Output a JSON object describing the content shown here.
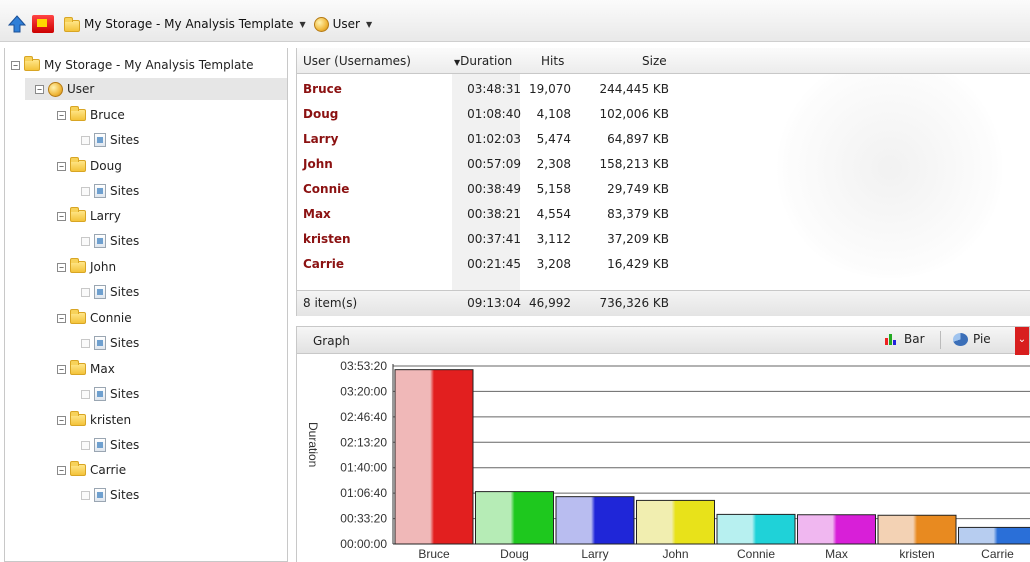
{
  "toolbar": {
    "breadcrumb_storage": "My Storage - My Analysis Template",
    "breadcrumb_user": "User"
  },
  "tree": {
    "root": "My Storage - My Analysis Template",
    "user": "User",
    "users": [
      {
        "name": "Bruce",
        "child": "Sites"
      },
      {
        "name": "Doug",
        "child": "Sites"
      },
      {
        "name": "Larry",
        "child": "Sites"
      },
      {
        "name": "John",
        "child": "Sites"
      },
      {
        "name": "Connie",
        "child": "Sites"
      },
      {
        "name": "Max",
        "child": "Sites"
      },
      {
        "name": "kristen",
        "child": "Sites"
      },
      {
        "name": "Carrie",
        "child": "Sites"
      }
    ]
  },
  "table": {
    "columns": [
      "User (Usernames)",
      "Duration",
      "Hits",
      "Size"
    ],
    "rows": [
      {
        "user": "Bruce",
        "duration": "03:48:31",
        "hits": "19,070",
        "size": "244,445 KB"
      },
      {
        "user": "Doug",
        "duration": "01:08:40",
        "hits": "4,108",
        "size": "102,006 KB"
      },
      {
        "user": "Larry",
        "duration": "01:02:03",
        "hits": "5,474",
        "size": "64,897 KB"
      },
      {
        "user": "John",
        "duration": "00:57:09",
        "hits": "2,308",
        "size": "158,213 KB"
      },
      {
        "user": "Connie",
        "duration": "00:38:49",
        "hits": "5,158",
        "size": "29,749 KB"
      },
      {
        "user": "Max",
        "duration": "00:38:21",
        "hits": "4,554",
        "size": "83,379 KB"
      },
      {
        "user": "kristen",
        "duration": "00:37:41",
        "hits": "3,112",
        "size": "37,209 KB"
      },
      {
        "user": "Carrie",
        "duration": "00:21:45",
        "hits": "3,208",
        "size": "16,429 KB"
      }
    ],
    "footer": {
      "count": "8 item(s)",
      "duration": "09:13:04",
      "hits": "46,992",
      "size": "736,326 KB"
    }
  },
  "graph": {
    "title": "Graph",
    "bar_label": "Bar",
    "pie_label": "Pie"
  },
  "chart_data": {
    "type": "bar",
    "ylabel": "Duration",
    "categories": [
      "Bruce",
      "Doug",
      "Larry",
      "John",
      "Connie",
      "Max",
      "kristen",
      "Carrie"
    ],
    "values": [
      "03:48:31",
      "01:08:40",
      "01:02:03",
      "00:57:09",
      "00:38:49",
      "00:38:21",
      "00:37:41",
      "00:21:45"
    ],
    "y_ticks": [
      "00:00:00",
      "00:33:20",
      "01:06:40",
      "01:40:00",
      "02:13:20",
      "02:46:40",
      "03:20:00",
      "03:53:20"
    ],
    "ylim": [
      "00:00:00",
      "03:53:20"
    ],
    "grid": true,
    "colors": [
      [
        "#f0b8b8",
        "#e21f1f"
      ],
      [
        "#b6ecb6",
        "#1ec81e"
      ],
      [
        "#b9bdf0",
        "#1f26d8"
      ],
      [
        "#f1eeb0",
        "#e8e21a"
      ],
      [
        "#b7f0f0",
        "#1fd2d8"
      ],
      [
        "#f0b7f0",
        "#d81fd8"
      ],
      [
        "#f3d2b4",
        "#e88a20"
      ],
      [
        "#b7cdf0",
        "#2a6fd8"
      ]
    ]
  }
}
